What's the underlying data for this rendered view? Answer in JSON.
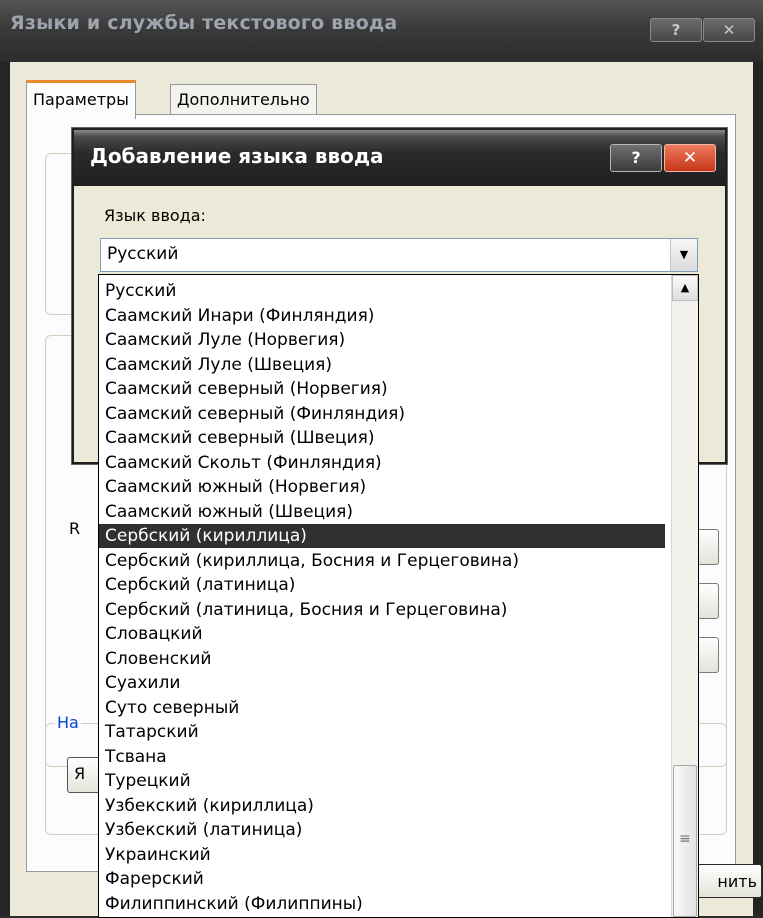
{
  "outer": {
    "title": "Языки и службы текстового ввода",
    "help_btn": "?",
    "close_btn": "✕",
    "tabs": [
      "Параметры",
      "Дополнительно"
    ],
    "group_label_partial": "На",
    "partial_letter_r": "R",
    "partial_letter_i": "Я",
    "bottom_btn_partial": "нить"
  },
  "dialog": {
    "title": "Добавление языка ввода",
    "help_btn": "?",
    "close_btn": "✕",
    "lang_label": "Язык ввода:",
    "combo_value": "Русский"
  },
  "dropdown": {
    "items": [
      "Русский",
      "Саамский Инари (Финляндия)",
      "Саамский Луле (Норвегия)",
      "Саамский Луле (Швеция)",
      "Саамский северный (Норвегия)",
      "Саамский северный (Финляндия)",
      "Саамский северный (Швеция)",
      "Саамский Скольт (Финляндия)",
      "Саамский южный (Норвегия)",
      "Саамский южный (Швеция)",
      "Сербский (кириллица)",
      "Сербский (кириллица, Босния и Герцеговина)",
      "Сербский (латиница)",
      "Сербский (латиница, Босния и Герцеговина)",
      "Словацкий",
      "Словенский",
      "Суахили",
      "Суто северный",
      "Татарский",
      "Тсвана",
      "Турецкий",
      "Узбекский (кириллица)",
      "Узбекский (латиница)",
      "Украинский",
      "Фарерский",
      "Филиппинский (Филиппины)"
    ],
    "selected_index": 10
  }
}
